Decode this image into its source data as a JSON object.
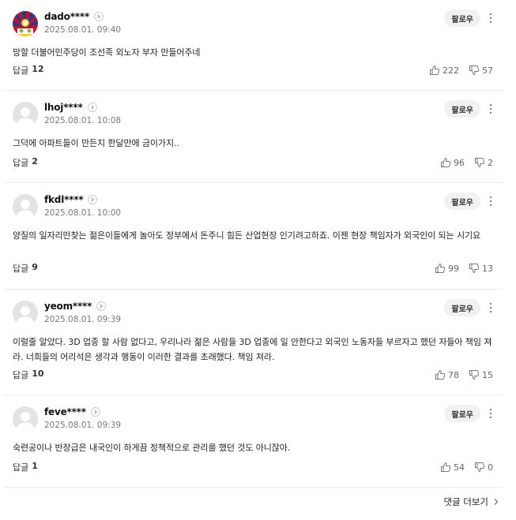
{
  "follow_label": "팔로우",
  "reply_label": "답글",
  "more_comments_label": "댓글 더보기",
  "comments": [
    {
      "nickname": "dado****",
      "date": "2025.08.01. 09:40",
      "text": "망할 더불어민주당이 조선족 외노자 부자 만들어주네",
      "reply_count": "12",
      "likes": "222",
      "dislikes": "57",
      "avatar": "flag"
    },
    {
      "nickname": "lhoj****",
      "date": "2025.08.01. 10:08",
      "text": "그덕에 아파트들이 만든지 한달만에 금이가지..",
      "reply_count": "2",
      "likes": "96",
      "dislikes": "2",
      "avatar": "default"
    },
    {
      "nickname": "fkdl****",
      "date": "2025.08.01. 10:00",
      "text": "양질의 일자리만찾는 젊은이들에게 놀아도 정부에서 돈주니 힘든 산업현장 인기려고하죠. 이젠 현장 책임자가 외국인이 되는 시기요",
      "reply_count": "9",
      "likes": "99",
      "dislikes": "13",
      "avatar": "default"
    },
    {
      "nickname": "yeom****",
      "date": "2025.08.01. 09:39",
      "text": "이럴줄 알았다. 3D 업종 할 사람 없다고, 우리나라 젊은 사람들 3D 업종에 일 안한다고 외국인 노동자들 부르자고 했던 자들아 책임 져라. 너희들의 어리석은 생각과 행동이 이러한 결과를 초래했다. 책임 져라.",
      "reply_count": "10",
      "likes": "78",
      "dislikes": "15",
      "avatar": "default"
    },
    {
      "nickname": "feve****",
      "date": "2025.08.01. 09:39",
      "text": "숙련공이나 반장급은 내국인이 하게끔 정책적으로 관리를 했던 것도 아니잖아.",
      "reply_count": "1",
      "likes": "54",
      "dislikes": "0",
      "avatar": "default"
    }
  ]
}
